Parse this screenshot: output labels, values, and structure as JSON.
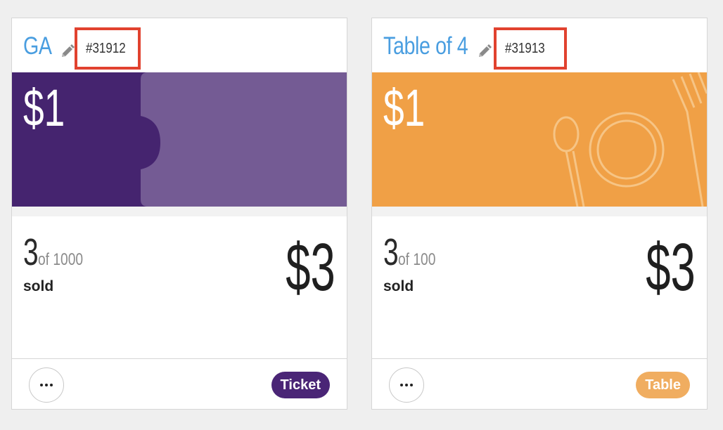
{
  "cards": [
    {
      "name": "GA",
      "id": "#31912",
      "price": "$1",
      "sold": "3",
      "of": "of 1000",
      "sold_label": "sold",
      "revenue": "$3",
      "type": "Ticket",
      "type_color": "#4a2576",
      "banner_colors": {
        "dark": "#45246f",
        "light": "#745b94"
      },
      "icons": [
        "pencil-icon",
        "more-icon"
      ]
    },
    {
      "name": "Table of 4",
      "id": "#31913",
      "price": "$1",
      "sold": "3",
      "of": "of 100",
      "sold_label": "sold",
      "revenue": "$3",
      "type": "Table",
      "type_color": "#f0ad60",
      "banner_colors": {
        "base": "#f0a046",
        "line": "#f7c98c"
      },
      "icons": [
        "pencil-icon",
        "more-icon",
        "plate-cutlery-icon"
      ]
    }
  ],
  "colors": {
    "link": "#4a9ee0",
    "highlight_border": "#e1422f",
    "background": "#efefef"
  }
}
